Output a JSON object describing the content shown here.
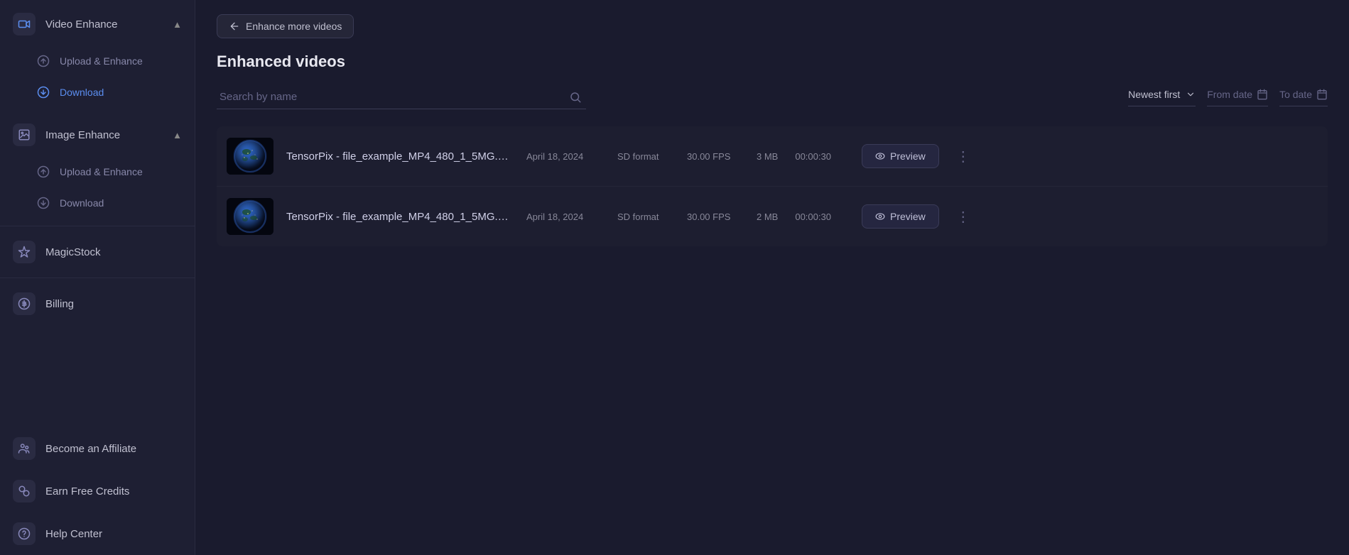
{
  "sidebar": {
    "videoEnhance": {
      "label": "Video Enhance",
      "expanded": true,
      "children": [
        {
          "id": "video-upload",
          "label": "Upload & Enhance"
        },
        {
          "id": "video-download",
          "label": "Download",
          "active": true
        }
      ]
    },
    "imageEnhance": {
      "label": "Image Enhance",
      "expanded": true,
      "children": [
        {
          "id": "image-upload",
          "label": "Upload & Enhance"
        },
        {
          "id": "image-download",
          "label": "Download"
        }
      ]
    },
    "magicstock": {
      "label": "MagicStock"
    },
    "billing": {
      "label": "Billing"
    },
    "affiliate": {
      "label": "Become an Affiliate"
    },
    "credits": {
      "label": "Earn Free Credits"
    },
    "help": {
      "label": "Help Center"
    }
  },
  "header": {
    "back_button": "Enhance more videos",
    "page_title": "Enhanced videos"
  },
  "filters": {
    "search_placeholder": "Search by name",
    "sort_label": "Newest first",
    "from_date_label": "From date",
    "to_date_label": "To date"
  },
  "videos": [
    {
      "id": 1,
      "name": "TensorPix - file_example_MP4_480_1_5MG.m...",
      "date": "April 18, 2024",
      "format": "SD format",
      "fps": "30.00 FPS",
      "size": "3 MB",
      "duration": "00:00:30",
      "preview_label": "Preview"
    },
    {
      "id": 2,
      "name": "TensorPix - file_example_MP4_480_1_5MG.m...",
      "date": "April 18, 2024",
      "format": "SD format",
      "fps": "30.00 FPS",
      "size": "2 MB",
      "duration": "00:00:30",
      "preview_label": "Preview"
    }
  ],
  "colors": {
    "accent": "#5b8ef0",
    "bg_sidebar": "#1e1f33",
    "bg_main": "#1a1b2e",
    "bg_row": "#1d1e30",
    "text_primary": "#e0e0e0",
    "text_secondary": "#888899"
  }
}
